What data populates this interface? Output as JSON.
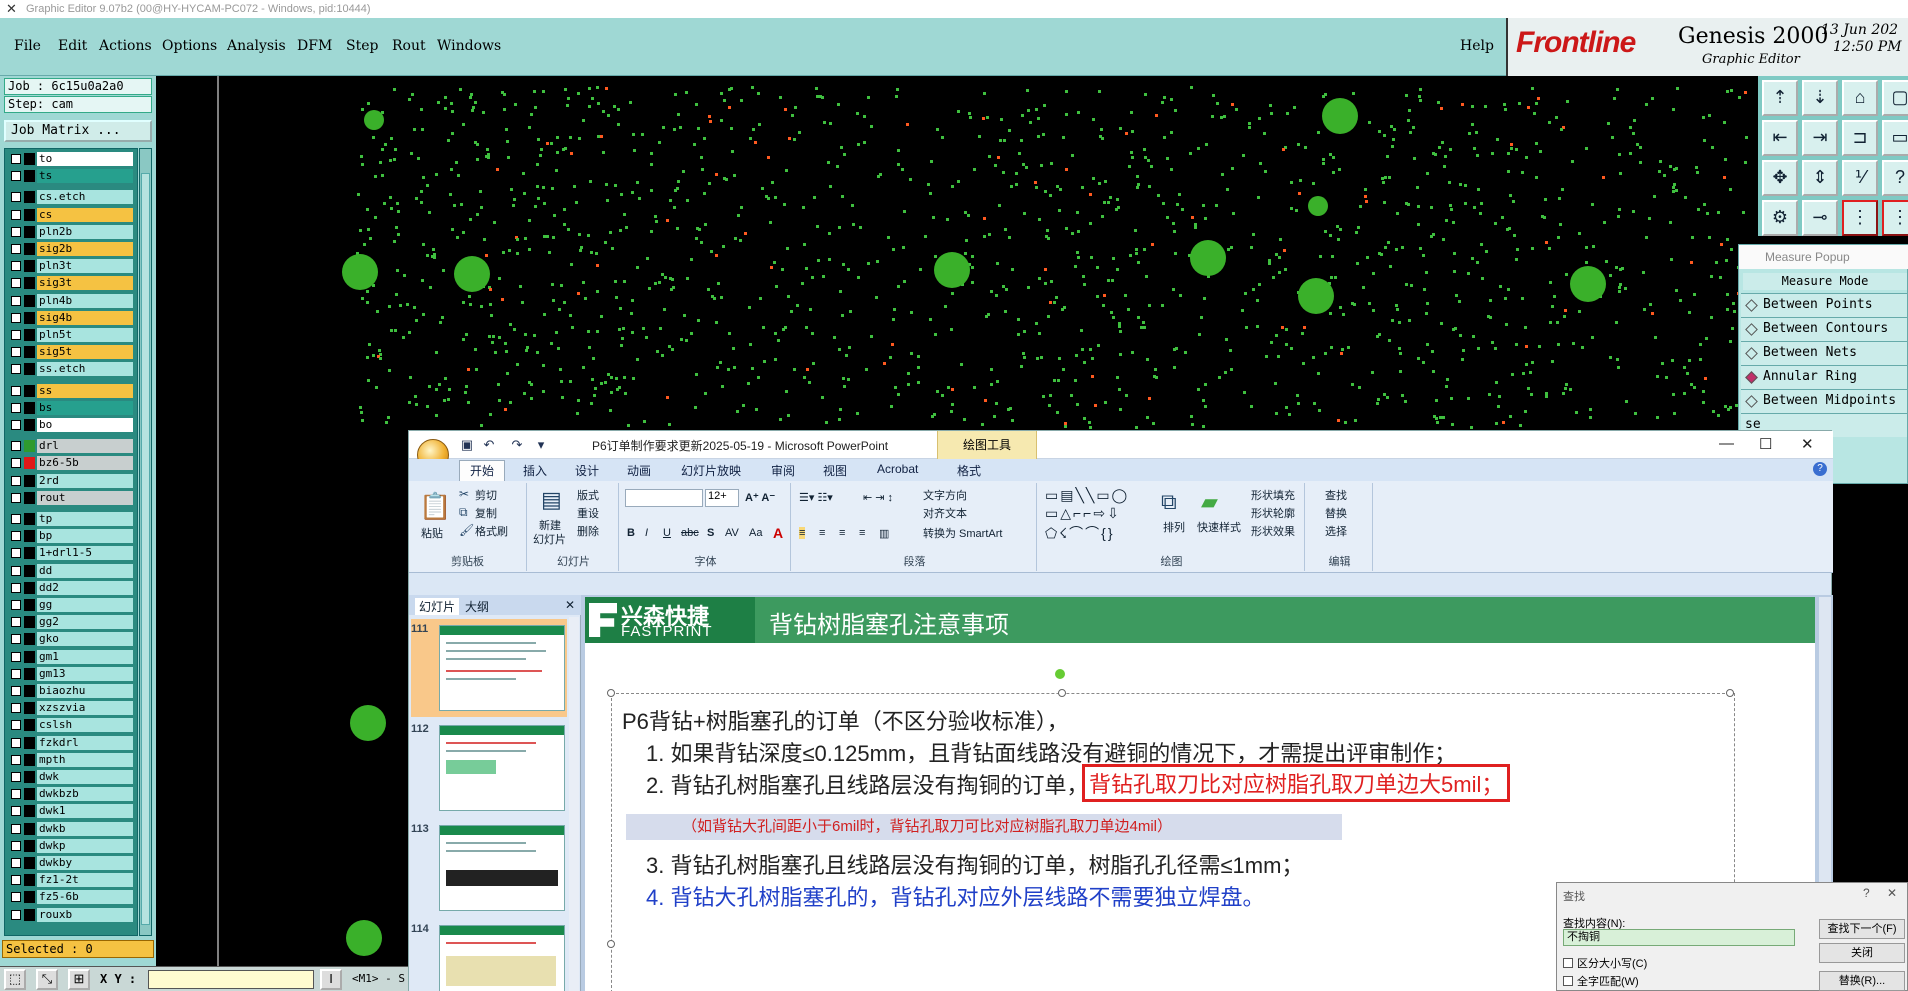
{
  "window": {
    "title": "Graphic Editor 9.07b2 (00@HY-HYCAM-PC072 - Windows, pid:10444)"
  },
  "menu": {
    "items": [
      "File",
      "Edit",
      "Actions",
      "Options",
      "Analysis",
      "DFM",
      "Step",
      "Rout",
      "Windows"
    ],
    "help": "Help"
  },
  "brand": {
    "logo": "Frontline",
    "product": "Genesis 2000",
    "subtitle": "Graphic Editor",
    "date": "13 Jun 202",
    "time": "12:50 PM"
  },
  "job": {
    "job_line": "Job : 6c15u0a2a0",
    "step_line": "Step: cam",
    "matrix_button": "Job Matrix ..."
  },
  "layers": [
    {
      "name": "to",
      "color": "#ffffff",
      "swatch": "#000000"
    },
    {
      "name": "ts",
      "color": "#26a08e",
      "swatch": "#000000"
    },
    {
      "name": "cs.etch",
      "color": "#a8e4df",
      "swatch": "#000000"
    },
    {
      "name": "cs",
      "color": "#f5c242",
      "swatch": "#000000"
    },
    {
      "name": "pln2b",
      "color": "#a8e4df",
      "swatch": "#000000"
    },
    {
      "name": "sig2b",
      "color": "#f5c242",
      "swatch": "#000000"
    },
    {
      "name": "pln3t",
      "color": "#a8e4df",
      "swatch": "#000000"
    },
    {
      "name": "sig3t",
      "color": "#f5c242",
      "swatch": "#000000"
    },
    {
      "name": "pln4b",
      "color": "#a8e4df",
      "swatch": "#000000"
    },
    {
      "name": "sig4b",
      "color": "#f5c242",
      "swatch": "#000000"
    },
    {
      "name": "pln5t",
      "color": "#a8e4df",
      "swatch": "#000000"
    },
    {
      "name": "sig5t",
      "color": "#f5c242",
      "swatch": "#000000"
    },
    {
      "name": "ss.etch",
      "color": "#a8e4df",
      "swatch": "#000000"
    },
    {
      "name": "ss",
      "color": "#f5c242",
      "swatch": "#000000"
    },
    {
      "name": "bs",
      "color": "#26a08e",
      "swatch": "#000000"
    },
    {
      "name": "bo",
      "color": "#ffffff",
      "swatch": "#000000"
    },
    {
      "name": "drl",
      "color": "#c8cfcf",
      "swatch": "#2e9a2e"
    },
    {
      "name": "bz6-5b",
      "color": "#c8cfcf",
      "swatch": "#e01818"
    },
    {
      "name": "2rd",
      "color": "#a8e4df",
      "swatch": "#000000"
    },
    {
      "name": "rout",
      "color": "#c8cfcf",
      "swatch": "#000000"
    },
    {
      "name": "tp",
      "color": "#a8e4df",
      "swatch": "#000000"
    },
    {
      "name": "bp",
      "color": "#a8e4df",
      "swatch": "#000000"
    },
    {
      "name": "1+drl1-5",
      "color": "#a8e4df",
      "swatch": "#000000"
    },
    {
      "name": "dd",
      "color": "#a8e4df",
      "swatch": "#000000"
    },
    {
      "name": "dd2",
      "color": "#a8e4df",
      "swatch": "#000000"
    },
    {
      "name": "gg",
      "color": "#a8e4df",
      "swatch": "#000000"
    },
    {
      "name": "gg2",
      "color": "#a8e4df",
      "swatch": "#000000"
    },
    {
      "name": "gko",
      "color": "#a8e4df",
      "swatch": "#000000"
    },
    {
      "name": "gm1",
      "color": "#a8e4df",
      "swatch": "#000000"
    },
    {
      "name": "gm13",
      "color": "#a8e4df",
      "swatch": "#000000"
    },
    {
      "name": "biaozhu",
      "color": "#a8e4df",
      "swatch": "#000000"
    },
    {
      "name": "xzszvia",
      "color": "#a8e4df",
      "swatch": "#000000"
    },
    {
      "name": "cslsh",
      "color": "#a8e4df",
      "swatch": "#000000"
    },
    {
      "name": "fzkdrl",
      "color": "#a8e4df",
      "swatch": "#000000"
    },
    {
      "name": "mpth",
      "color": "#a8e4df",
      "swatch": "#000000"
    },
    {
      "name": "dwk",
      "color": "#a8e4df",
      "swatch": "#000000"
    },
    {
      "name": "dwkbzb",
      "color": "#a8e4df",
      "swatch": "#000000"
    },
    {
      "name": "dwk1",
      "color": "#a8e4df",
      "swatch": "#000000"
    },
    {
      "name": "dwkb",
      "color": "#a8e4df",
      "swatch": "#000000"
    },
    {
      "name": "dwkp",
      "color": "#a8e4df",
      "swatch": "#000000"
    },
    {
      "name": "dwkby",
      "color": "#a8e4df",
      "swatch": "#000000"
    },
    {
      "name": "fz1-2t",
      "color": "#a8e4df",
      "swatch": "#000000"
    },
    {
      "name": "fz5-6b",
      "color": "#a8e4df",
      "swatch": "#000000"
    },
    {
      "name": "rouxb",
      "color": "#a8e4df",
      "swatch": "#000000"
    }
  ],
  "status": {
    "selected": "Selected : 0",
    "xy_label": "X Y :",
    "mode": "<M1> - S"
  },
  "measure": {
    "title": "Measure Popup",
    "mode_label": "Measure Mode",
    "options": [
      "Between Points",
      "Between Contours",
      "Between Nets",
      "Annular Ring",
      "Between Midpoints"
    ],
    "active": 3,
    "partial": "se"
  },
  "ppt": {
    "title": "P6订单制作要求更新2025-05-19 - Microsoft PowerPoint",
    "context_tab": "绘图工具",
    "tabs": [
      "开始",
      "插入",
      "设计",
      "动画",
      "幻灯片放映",
      "审阅",
      "视图",
      "Acrobat",
      "格式"
    ],
    "groups": {
      "clipboard": {
        "name": "剪贴板",
        "paste": "粘贴",
        "cut": "剪切",
        "copy": "复制",
        "format_painter": "格式刷"
      },
      "slides": {
        "name": "幻灯片",
        "new_slide": "新建",
        "new_slide2": "幻灯片",
        "layout": "版式",
        "reset": "重设",
        "delete": "删除"
      },
      "font": {
        "name": "字体",
        "size": "12+"
      },
      "paragraph": {
        "name": "段落",
        "text_direction": "文字方向",
        "align_text": "对齐文本",
        "smartart": "转换为 SmartArt"
      },
      "drawing": {
        "name": "绘图",
        "arrange": "排列",
        "quick_styles": "快速样式",
        "fill": "形状填充",
        "outline": "形状轮廓",
        "effects": "形状效果"
      },
      "editing": {
        "name": "编辑",
        "find": "查找",
        "replace": "替换",
        "select": "选择"
      }
    },
    "pane_tabs": [
      "幻灯片",
      "大纲"
    ],
    "thumbs": [
      "111",
      "112",
      "113",
      "114"
    ],
    "slide": {
      "logo_cn": "兴森快捷",
      "logo_en": "FASTPRINT",
      "title": "背钻树脂塞孔注意事项",
      "heading": "P6背钻+树脂塞孔的订单（不区分验收标准），",
      "line1": "1. 如果背钻深度≤0.125mm，且背钻面线路没有避铜的情况下，才需提出评审制作；",
      "line2": "2. 背钻孔树脂塞孔且线路层没有掏铜的订单，",
      "line2_highlight": "背钻孔取刀比对应树脂孔取刀单边大5mil；",
      "note": "（如背钻大孔间距小于6mil时，背钻孔取刀可比对应树脂孔取刀单边4mil）",
      "line3": "3. 背钻孔树脂塞孔且线路层没有掏铜的订单，树脂孔孔径需≤1mm；",
      "line4": "4. 背钻大孔树脂塞孔的，背钻孔对应外层线路不需要独立焊盘。"
    }
  },
  "find": {
    "title": "查找",
    "content_label": "查找内容(N):",
    "value": "不掏铜",
    "match_case": "区分大小写(C)",
    "whole_word": "全字匹配(W)",
    "find_next": "查找下一个(F)",
    "close": "关闭",
    "replace": "替换(R)..."
  }
}
